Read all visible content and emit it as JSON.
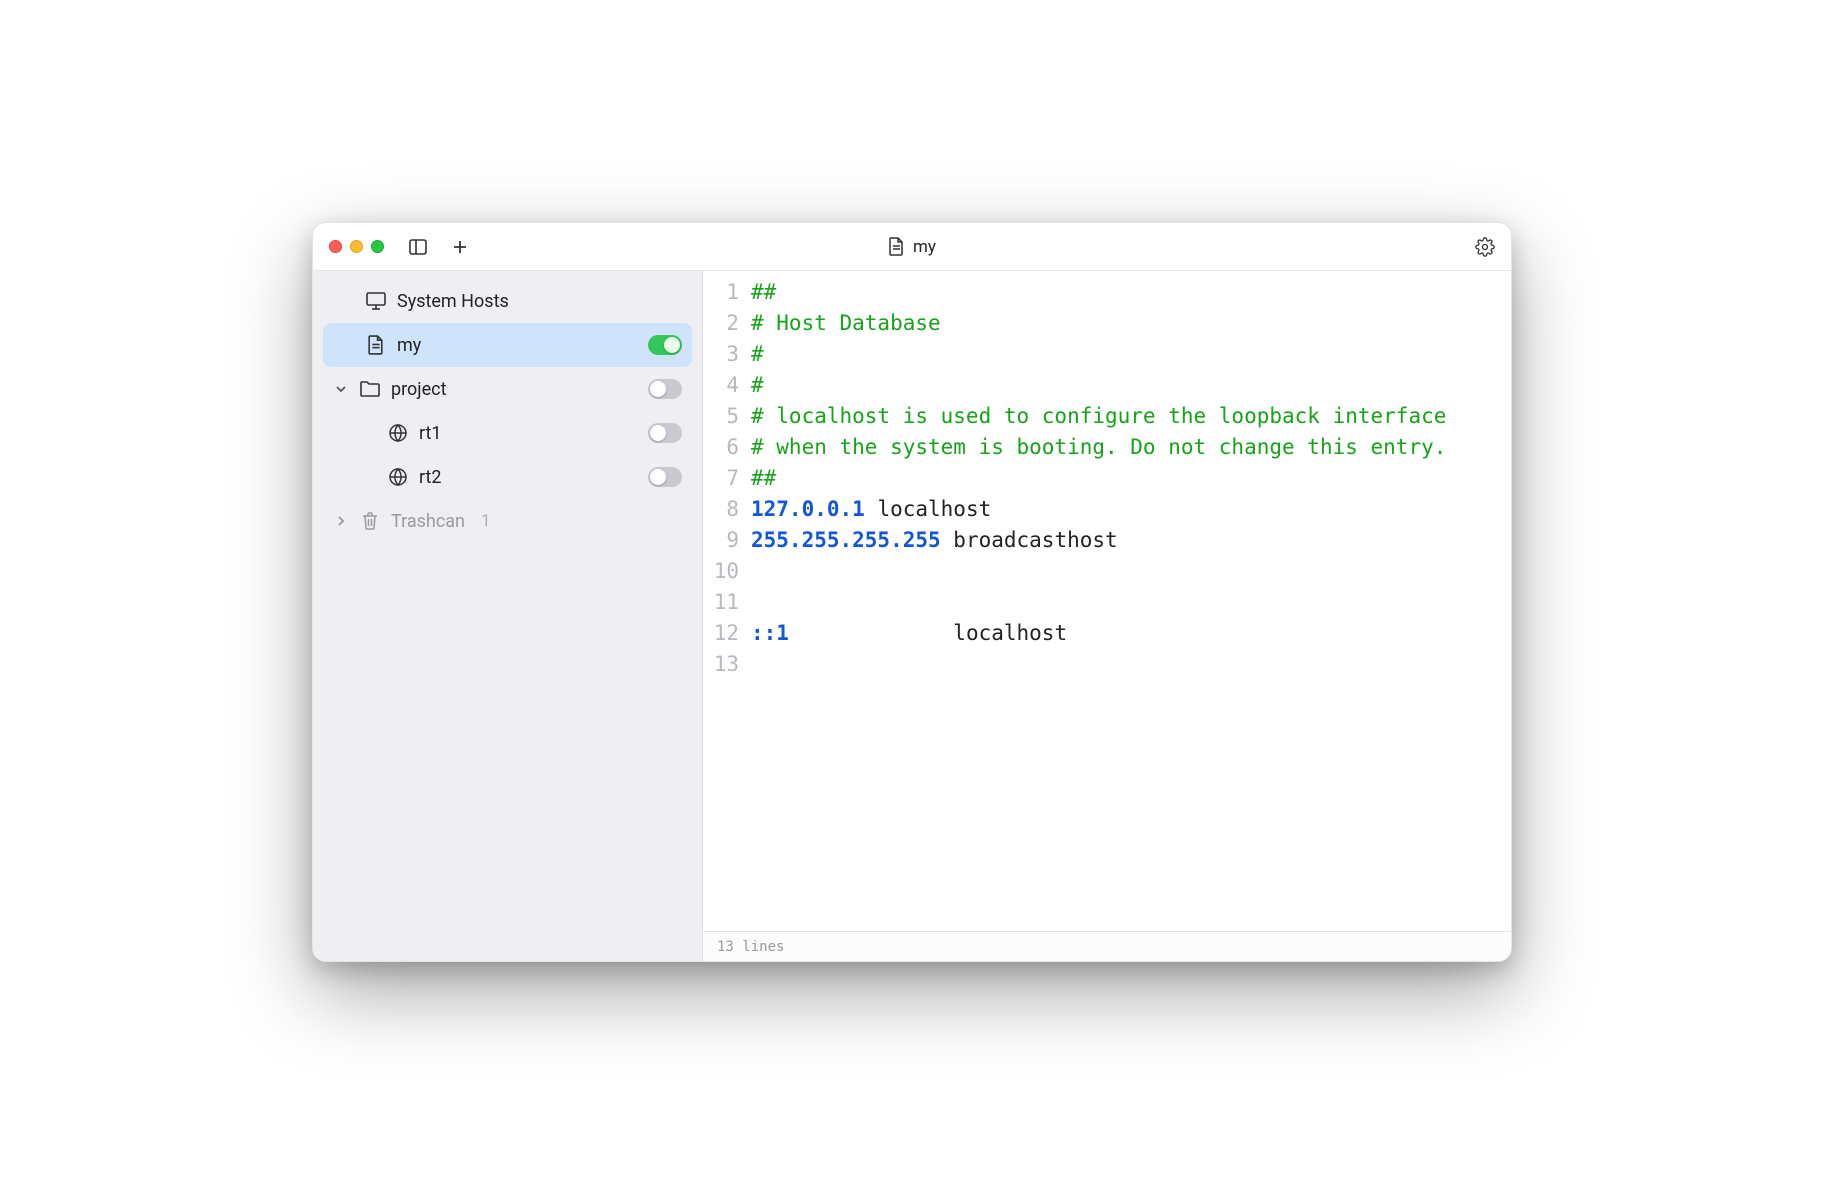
{
  "title": "my",
  "sidebar": {
    "system_hosts": "System Hosts",
    "my": "my",
    "project": "project",
    "rt1": "rt1",
    "rt2": "rt2",
    "trashcan": "Trashcan",
    "trashcan_count": "1",
    "toggles": {
      "my": true,
      "project": false,
      "rt1": false,
      "rt2": false
    }
  },
  "editor": {
    "lines": [
      {
        "n": 1,
        "tokens": [
          {
            "t": "##",
            "c": "comment"
          }
        ]
      },
      {
        "n": 2,
        "tokens": [
          {
            "t": "# Host Database",
            "c": "comment"
          }
        ]
      },
      {
        "n": 3,
        "tokens": [
          {
            "t": "#",
            "c": "comment"
          }
        ]
      },
      {
        "n": 4,
        "tokens": [
          {
            "t": "#",
            "c": "comment"
          }
        ]
      },
      {
        "n": 5,
        "tokens": [
          {
            "t": "# localhost is used to configure the loopback interface",
            "c": "comment"
          }
        ]
      },
      {
        "n": 6,
        "tokens": [
          {
            "t": "# when the system is booting. Do not change this entry.",
            "c": "comment"
          }
        ]
      },
      {
        "n": 7,
        "tokens": [
          {
            "t": "##",
            "c": "comment"
          }
        ]
      },
      {
        "n": 8,
        "tokens": [
          {
            "t": "127.0.0.1",
            "c": "ip"
          },
          {
            "t": " localhost",
            "c": "plain"
          }
        ]
      },
      {
        "n": 9,
        "tokens": [
          {
            "t": "255.255.255.255",
            "c": "ip"
          },
          {
            "t": " broadcasthost",
            "c": "plain"
          }
        ]
      },
      {
        "n": 10,
        "tokens": []
      },
      {
        "n": 11,
        "tokens": []
      },
      {
        "n": 12,
        "tokens": [
          {
            "t": "::1",
            "c": "ip"
          },
          {
            "t": "             localhost",
            "c": "plain"
          }
        ]
      },
      {
        "n": 13,
        "tokens": []
      }
    ]
  },
  "status": "13 lines"
}
